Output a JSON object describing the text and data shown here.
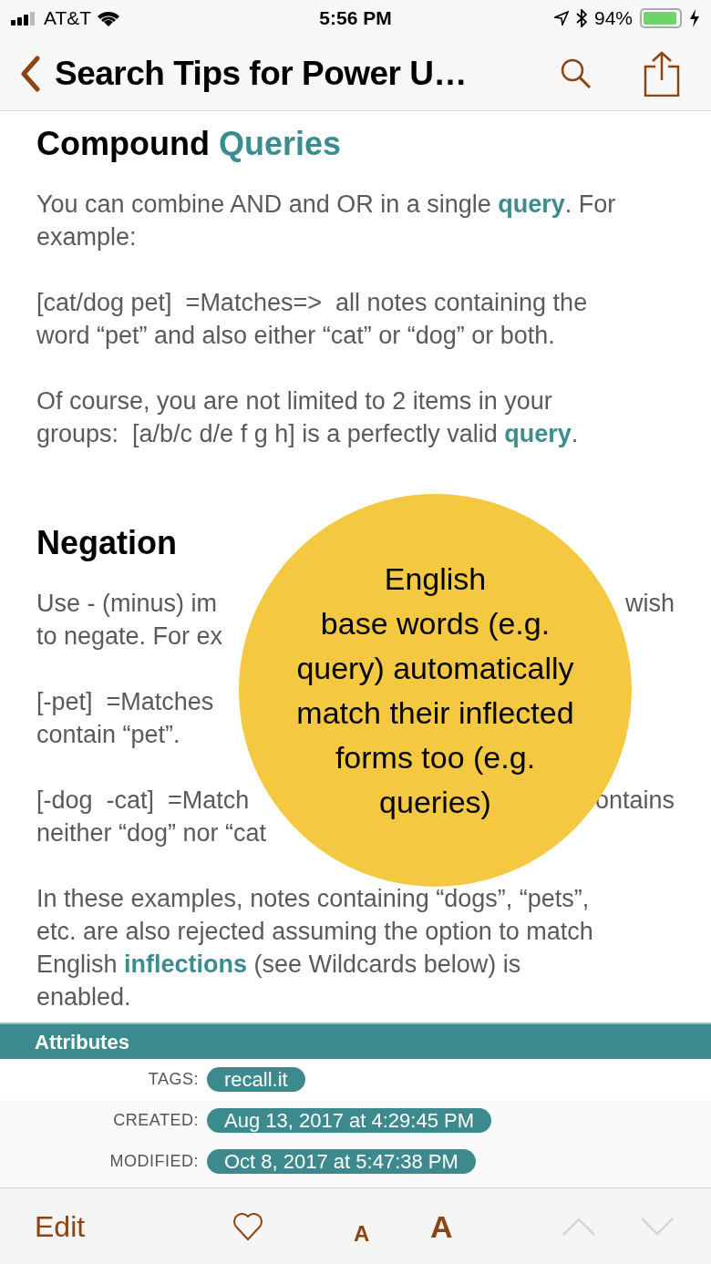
{
  "status_bar": {
    "carrier": "AT&T",
    "time": "5:56 PM",
    "battery": "94%"
  },
  "nav": {
    "title": "Search Tips for Power U…"
  },
  "content": [
    {
      "kind": "heading",
      "lines": [
        {
          "segments": [
            {
              "kind": "plain",
              "text": "Compound "
            },
            {
              "kind": "link",
              "text": "Queries"
            }
          ]
        }
      ]
    },
    {
      "kind": "paragraph",
      "lines": [
        {
          "segments": [
            {
              "kind": "plain",
              "text": "You can combine AND and OR in a single "
            },
            {
              "kind": "link",
              "text": "query"
            },
            {
              "kind": "plain",
              "text": ". For"
            }
          ]
        },
        {
          "segments": [
            {
              "kind": "plain",
              "text": "example:"
            }
          ]
        }
      ]
    },
    {
      "kind": "paragraph",
      "lines": [
        {
          "segments": [
            {
              "kind": "plain",
              "text": "[cat/dog pet]  =Matches=>  all notes containing the"
            }
          ]
        },
        {
          "segments": [
            {
              "kind": "plain",
              "text": "word “pet” and also either “cat” or “dog” or both."
            }
          ]
        }
      ]
    },
    {
      "kind": "paragraph",
      "lines": [
        {
          "segments": [
            {
              "kind": "plain",
              "text": "Of course, you are not limited to 2 items in your"
            }
          ]
        },
        {
          "segments": [
            {
              "kind": "plain",
              "text": "groups:  [a/b/c d/e f g h] is a perfectly valid "
            },
            {
              "kind": "link",
              "text": "query"
            },
            {
              "kind": "plain",
              "text": "."
            }
          ]
        }
      ]
    },
    {
      "kind": "heading",
      "lines": [
        {
          "segments": [
            {
              "kind": "plain",
              "text": "Negation"
            }
          ]
        }
      ]
    },
    {
      "kind": "paragraph",
      "lines": [
        {
          "segments": [
            {
              "kind": "plain",
              "text": "Use - (minus) im"
            }
          ],
          "right": "wish"
        },
        {
          "segments": [
            {
              "kind": "plain",
              "text": "to negate. For ex"
            }
          ]
        }
      ]
    },
    {
      "kind": "paragraph",
      "lines": [
        {
          "segments": [
            {
              "kind": "plain",
              "text": "[-pet]  =Matches"
            }
          ]
        },
        {
          "segments": [
            {
              "kind": "plain",
              "text": "contain “pet”."
            }
          ]
        }
      ]
    },
    {
      "kind": "paragraph",
      "lines": [
        {
          "segments": [
            {
              "kind": "plain",
              "text": "[-dog  -cat]  =Match"
            }
          ],
          "right": "ontains"
        },
        {
          "segments": [
            {
              "kind": "plain",
              "text": "neither “dog” nor “cat"
            }
          ]
        }
      ]
    },
    {
      "kind": "paragraph",
      "lines": [
        {
          "segments": [
            {
              "kind": "plain",
              "text": "In these examples, notes containing “dogs”, “pets”,"
            }
          ]
        },
        {
          "segments": [
            {
              "kind": "plain",
              "text": "etc. are also rejected assuming the option to match"
            }
          ]
        },
        {
          "segments": [
            {
              "kind": "plain",
              "text": "English "
            },
            {
              "kind": "link",
              "text": "inflections"
            },
            {
              "kind": "plain",
              "text": " (see Wildcards below) is"
            }
          ]
        },
        {
          "segments": [
            {
              "kind": "plain",
              "text": "enabled."
            }
          ]
        }
      ]
    }
  ],
  "tooltip": {
    "lines": [
      "English",
      "base words (e.g.",
      "query) automatically",
      "match their inflected",
      "forms too (e.g.",
      "queries)"
    ]
  },
  "attributes": {
    "title": "Attributes",
    "rows": [
      {
        "label": "TAGS:",
        "value": "recall.it"
      },
      {
        "label": "CREATED:",
        "value": "Aug 13, 2017 at 4:29:45 PM"
      },
      {
        "label": "MODIFIED:",
        "value": "Oct 8, 2017 at 5:47:38 PM"
      }
    ]
  },
  "toolbar": [
    {
      "kind": "edit",
      "label": "Edit",
      "disabled": false
    },
    {
      "kind": "heart",
      "disabled": false
    },
    {
      "kind": "small-font",
      "label": "A",
      "disabled": false
    },
    {
      "kind": "large-font",
      "label": "A",
      "disabled": false
    },
    {
      "kind": "up",
      "disabled": true
    },
    {
      "kind": "down",
      "disabled": true
    }
  ]
}
